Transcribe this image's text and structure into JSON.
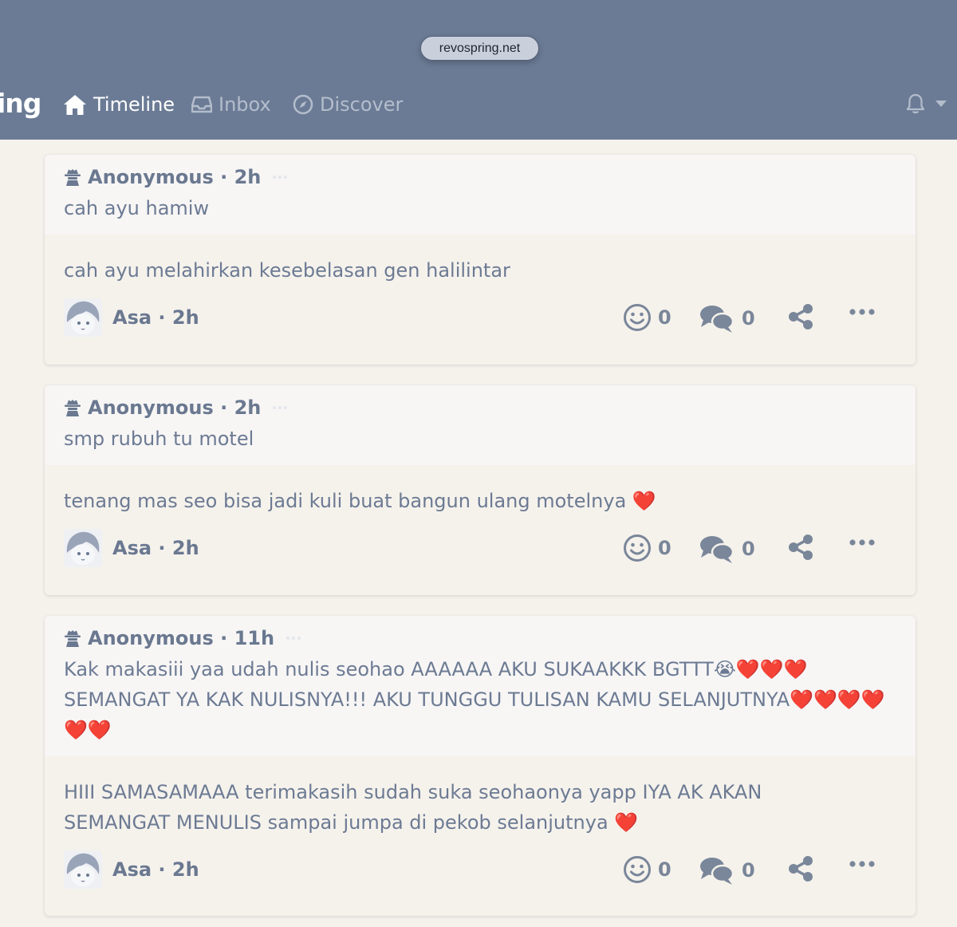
{
  "browser": {
    "url": "revospring.net"
  },
  "header": {
    "brand": "ing",
    "nav": [
      {
        "label": "Timeline",
        "icon": "home-icon",
        "active": true
      },
      {
        "label": "Inbox",
        "icon": "inbox-icon",
        "active": false
      },
      {
        "label": "Discover",
        "icon": "compass-icon",
        "active": false
      }
    ],
    "notifications_icon": "bell-icon"
  },
  "colors": {
    "header_bg": "#6b7b95",
    "page_bg": "#f5f2ec",
    "text": "#6c7a93"
  },
  "cards": [
    {
      "asker": "Anonymous",
      "asked_time": "2h",
      "question": "cah ayu hamiw",
      "answer": "cah ayu melahirkan kesebelasan gen halilintar",
      "answerer": "Asa",
      "answered_time": "2h",
      "smiles": "0",
      "comments": "0"
    },
    {
      "asker": "Anonymous",
      "asked_time": "2h",
      "question": "smp rubuh tu motel",
      "answer": "tenang mas seo bisa jadi kuli buat bangun ulang motelnya ❤️",
      "answerer": "Asa",
      "answered_time": "2h",
      "smiles": "0",
      "comments": "0"
    },
    {
      "asker": "Anonymous",
      "asked_time": "11h",
      "question": "Kak makasiii yaa udah nulis seohao AAAAAA AKU SUKAAKKK BGTTT😭❤️❤️❤️ SEMANGAT YA KAK NULISNYA!!! AKU TUNGGU TULISAN KAMU SELANJUTNYA❤️❤️❤️❤️❤️❤️",
      "answer": "HIII SAMASAMAAA terimakasih sudah suka seohaonya yapp IYA AK AKAN SEMANGAT MENULIS sampai jumpa di pekob selanjutnya ❤️",
      "answerer": "Asa",
      "answered_time": "2h",
      "smiles": "0",
      "comments": "0"
    }
  ]
}
